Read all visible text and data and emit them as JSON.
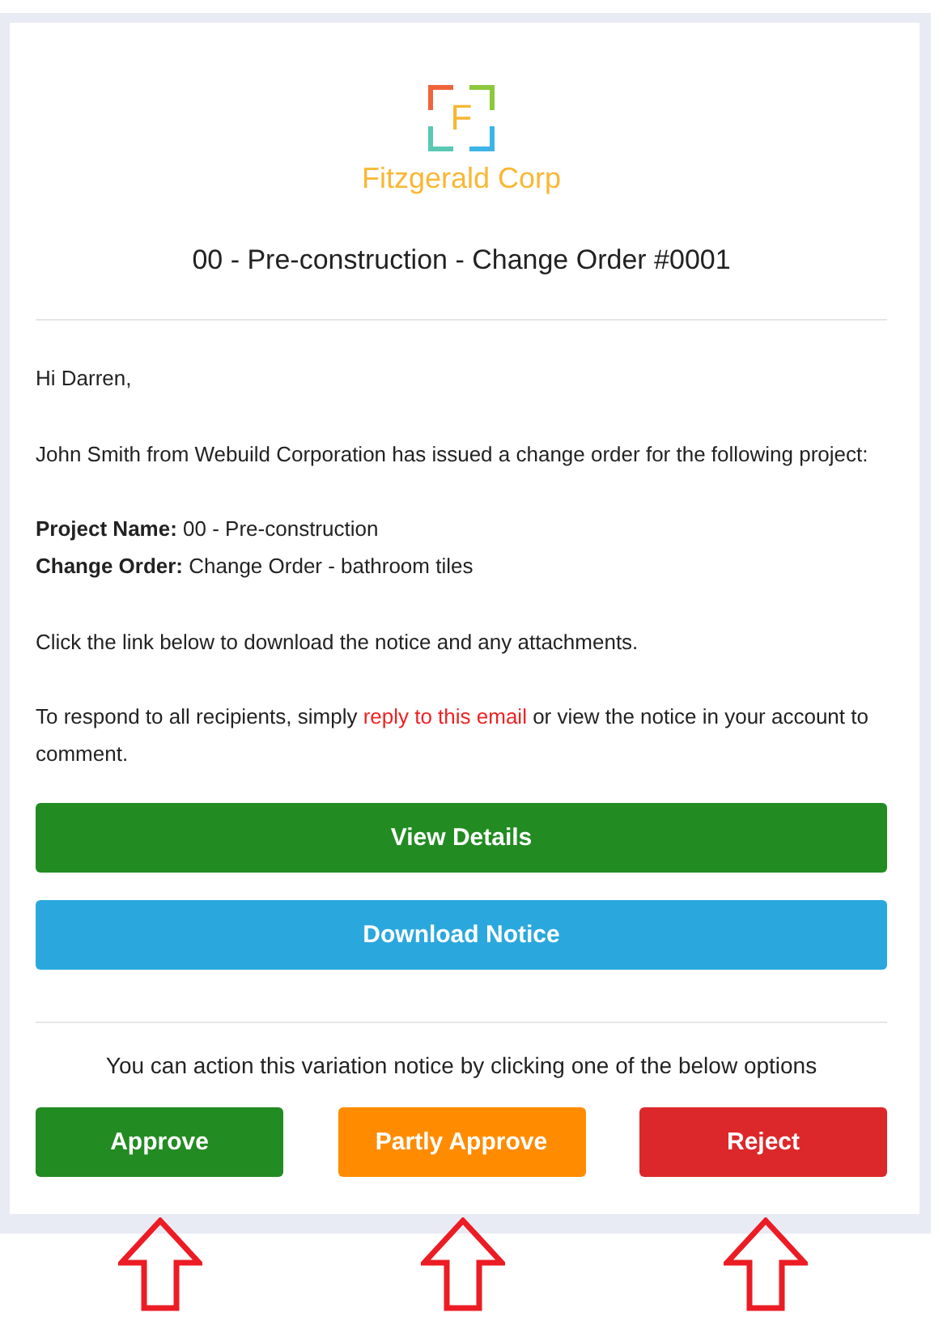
{
  "logo": {
    "letter": "F",
    "company": "Fitzgerald Corp"
  },
  "title": "00 - Pre-construction - Change Order #0001",
  "greeting": "Hi Darren,",
  "intro": "John Smith from Webuild Corporation has issued a change order for the following project:",
  "details": [
    "**Project Name:** 00 - Pre-construction",
    "**Change Order:** Change Order - bathroom tiles"
  ],
  "download_note": "Click the link below to download the notice and any attachments.",
  "respond": {
    "before": "To respond to all recipients, simply ",
    "link": "reply to this email",
    "after": " or view the notice in your account to comment."
  },
  "main_buttons": [
    {
      "label": "View Details",
      "color": "#228b22"
    },
    {
      "label": "Download Notice",
      "color": "#2aa8de"
    }
  ],
  "action_prompt": "You can action this variation notice by clicking one of the below options",
  "actions": [
    {
      "label": "Approve",
      "color": "#228b22"
    },
    {
      "label": "Partly Approve",
      "color": "#ff8c00"
    },
    {
      "label": "Reject",
      "color": "#dc282a"
    }
  ]
}
